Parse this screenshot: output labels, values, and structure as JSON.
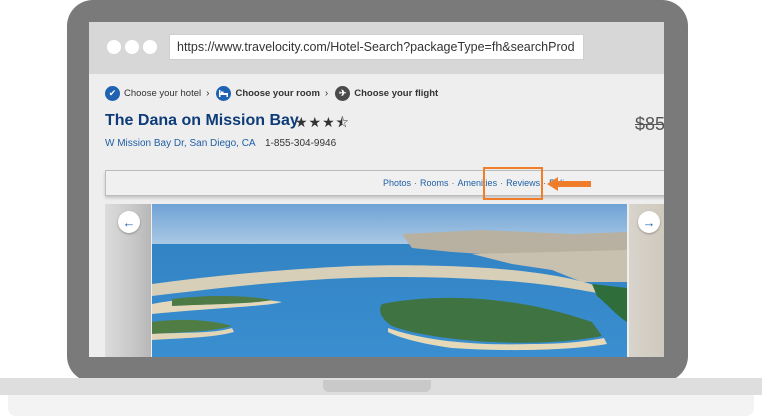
{
  "browser": {
    "url": "https://www.travelocity.com/Hotel-Search?packageType=fh&searchProd"
  },
  "steps": [
    {
      "label": "Choose your hotel",
      "icon": "checkmark-icon"
    },
    {
      "label": "Choose your room",
      "icon": "bed-icon"
    },
    {
      "label": "Choose your flight",
      "icon": "airplane-icon"
    }
  ],
  "hotel": {
    "name": "The Dana on Mission Bay",
    "stars": "★★★⯪",
    "address": "W Mission Bay Dr,  San Diego,  CA",
    "phone": "1-855-304-9946",
    "price": "$85"
  },
  "nav": {
    "photos": "Photos",
    "rooms": "Rooms",
    "amenities": "Amenities",
    "reviews": "Reviews",
    "policies": "Poli",
    "sep": "·"
  },
  "gallery": {
    "prev": "←",
    "next": "→"
  },
  "colors": {
    "accent": "#f07d2a",
    "brand": "#0d3c78",
    "link": "#1f5fa6"
  }
}
